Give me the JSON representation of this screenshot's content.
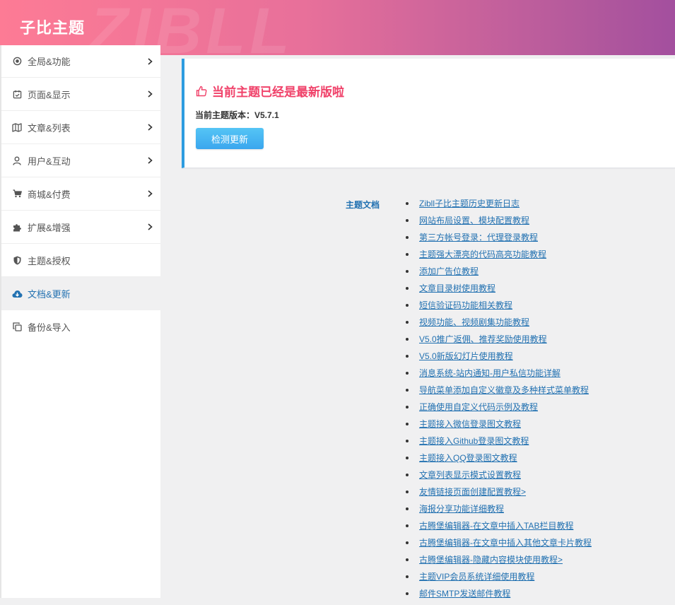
{
  "header": {
    "title": "子比主题",
    "watermark": "ZIBLL"
  },
  "sidebar": {
    "items": [
      {
        "label": "全局&功能",
        "icon": "target-icon",
        "arrow": true
      },
      {
        "label": "页面&显示",
        "icon": "calendar-check-icon",
        "arrow": true
      },
      {
        "label": "文章&列表",
        "icon": "map-icon",
        "arrow": true
      },
      {
        "label": "用户&互动",
        "icon": "user-icon",
        "arrow": true
      },
      {
        "label": "商城&付费",
        "icon": "cart-icon",
        "arrow": true
      },
      {
        "label": "扩展&增强",
        "icon": "puzzle-icon",
        "arrow": true
      },
      {
        "label": "主题&授权",
        "icon": "shield-icon",
        "arrow": false
      },
      {
        "label": "文档&更新",
        "icon": "cloud-download-icon",
        "arrow": false,
        "active": true
      },
      {
        "label": "备份&导入",
        "icon": "copy-icon",
        "arrow": false
      }
    ]
  },
  "notice": {
    "title": "当前主题已经是最新版啦",
    "version_text": "当前主题版本：V5.7.1",
    "check_button": "检测更新",
    "accent": "#2d9ce0",
    "title_color": "#f0426a"
  },
  "docs": {
    "heading": "主题文档",
    "links": [
      "Zibll子比主题历史更新日志",
      "网站布局设置、模块配置教程",
      "第三方帐号登录：代理登录教程",
      "主题强大漂亮的代码高亮功能教程",
      "添加广告位教程",
      "文章目录树使用教程",
      "短信验证码功能相关教程",
      "视频功能、视频剧集功能教程",
      "V5.0推广返佣、推荐奖励使用教程",
      "V5.0新版幻灯片使用教程",
      "消息系统-站内通知-用户私信功能详解",
      "导航菜单添加自定义徽章及多种样式菜单教程",
      "正确使用自定义代码示例及教程",
      "主题接入微信登录图文教程",
      "主题接入Github登录图文教程",
      "主题接入QQ登录图文教程",
      "文章列表显示模式设置教程",
      "友情链接页面创建配置教程>",
      "海报分享功能详细教程",
      "古腾堡编辑器-在文章中插入TAB栏目教程",
      "古腾堡编辑器-在文章中插入其他文章卡片教程",
      "古腾堡编辑器-隐藏内容模块使用教程>",
      "主题VIP会员系统详细使用教程",
      "邮件SMTP发送邮件教程"
    ]
  }
}
